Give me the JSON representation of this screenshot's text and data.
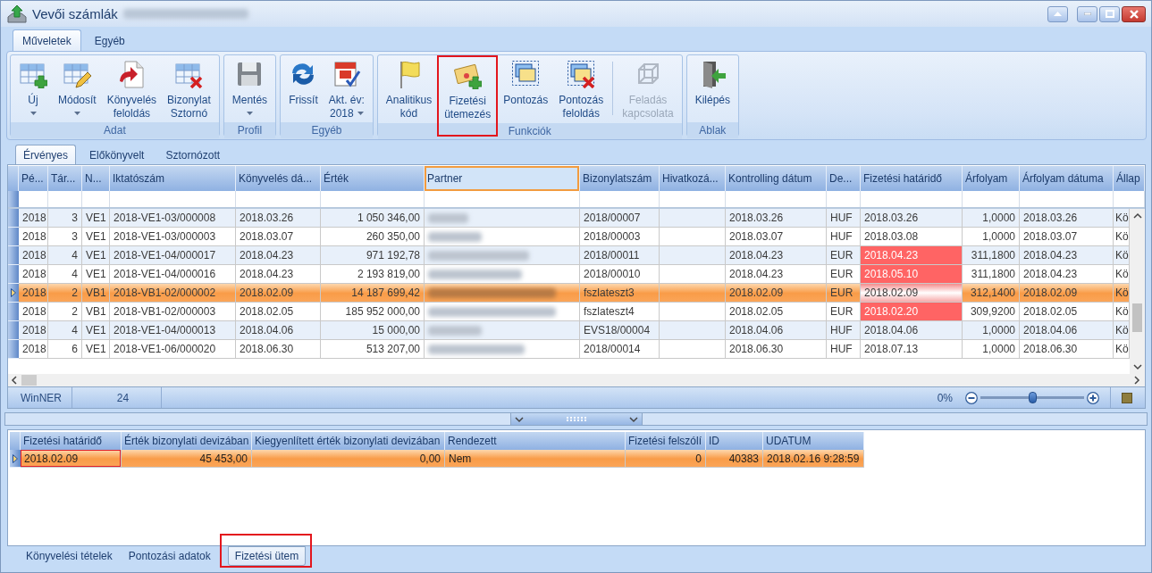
{
  "window": {
    "title": "Vevői számlák"
  },
  "ribbon": {
    "tabs": [
      {
        "label": "Műveletek",
        "selected": true
      },
      {
        "label": "Egyéb",
        "selected": false
      }
    ],
    "groups": [
      {
        "label": "Adat",
        "buttons": [
          {
            "kind": "button",
            "label": "Új",
            "menu": true,
            "disabled": false,
            "highlighted": false
          },
          {
            "kind": "button",
            "label": "Módosít",
            "menu": true,
            "disabled": false,
            "highlighted": false
          },
          {
            "kind": "button",
            "label": "Könyvelés\nfeloldás",
            "menu": false,
            "disabled": false,
            "highlighted": false
          },
          {
            "kind": "button",
            "label": "Bizonylat\nSztornó",
            "menu": false,
            "disabled": false,
            "highlighted": false
          }
        ]
      },
      {
        "label": "Profil",
        "buttons": [
          {
            "kind": "button",
            "label": "Mentés",
            "menu": true,
            "disabled": false,
            "highlighted": false
          }
        ]
      },
      {
        "label": "Egyéb",
        "buttons": [
          {
            "kind": "button",
            "label": "Frissít",
            "menu": false,
            "disabled": false,
            "highlighted": false
          },
          {
            "kind": "button",
            "label": "Akt. év:\n2018",
            "menu": true,
            "disabled": false,
            "highlighted": false
          }
        ]
      },
      {
        "label": "Funkciók",
        "buttons": [
          {
            "kind": "button",
            "label": "Analitikus\nkód",
            "menu": false,
            "disabled": false,
            "highlighted": false
          },
          {
            "kind": "button",
            "label": "Fizetési\nütemezés",
            "menu": false,
            "disabled": false,
            "highlighted": true
          },
          {
            "kind": "button",
            "label": "Pontozás",
            "menu": false,
            "disabled": false,
            "highlighted": false
          },
          {
            "kind": "button",
            "label": "Pontozás\nfeloldás",
            "menu": false,
            "disabled": false,
            "highlighted": false
          },
          {
            "kind": "separator"
          },
          {
            "kind": "button",
            "label": "Feladás\nkapcsolata",
            "menu": false,
            "disabled": true,
            "highlighted": false
          }
        ]
      },
      {
        "label": "Ablak",
        "buttons": [
          {
            "kind": "button",
            "label": "Kilépés",
            "menu": false,
            "disabled": false,
            "highlighted": false
          }
        ]
      }
    ]
  },
  "grid_tabs": [
    {
      "label": "Érvényes",
      "selected": true
    },
    {
      "label": "Előkönyvelt",
      "selected": false
    },
    {
      "label": "Sztornózott",
      "selected": false
    }
  ],
  "grid": {
    "columns": [
      {
        "label": "Pé...",
        "kind": "text",
        "focused": false
      },
      {
        "label": "Tár...",
        "kind": "number",
        "focused": false
      },
      {
        "label": "N...",
        "kind": "text",
        "focused": false
      },
      {
        "label": "Iktatószám",
        "kind": "text",
        "focused": false
      },
      {
        "label": "Könyvelés dá...",
        "kind": "text",
        "focused": false
      },
      {
        "label": "Érték",
        "kind": "number",
        "focused": false
      },
      {
        "label": "Partner",
        "kind": "redacted",
        "focused": true
      },
      {
        "label": "Bizonylatszám",
        "kind": "text",
        "focused": false
      },
      {
        "label": "Hivatkozá...",
        "kind": "text",
        "focused": false
      },
      {
        "label": "Kontrolling dátum",
        "kind": "text",
        "focused": false
      },
      {
        "label": "De...",
        "kind": "text",
        "focused": false
      },
      {
        "label": "Fizetési határidő",
        "kind": "deadline",
        "focused": false
      },
      {
        "label": "Árfolyam",
        "kind": "number",
        "focused": false
      },
      {
        "label": "Árfolyam dátuma",
        "kind": "text",
        "focused": false
      },
      {
        "label": "Állap",
        "kind": "text",
        "focused": false
      }
    ],
    "rows": [
      {
        "selected": false,
        "overdue": false,
        "cells": [
          "2018",
          "3",
          "VE1",
          "2018-VE1-03/000008",
          "2018.03.26",
          "1 050 346,00",
          null,
          "2018/00007",
          null,
          "2018.03.26",
          "HUF",
          "2018.03.26",
          "1,0000",
          "2018.03.26",
          "Kö"
        ]
      },
      {
        "selected": false,
        "overdue": false,
        "cells": [
          "2018",
          "3",
          "VE1",
          "2018-VE1-03/000003",
          "2018.03.07",
          "260 350,00",
          null,
          "2018/00003",
          null,
          "2018.03.07",
          "HUF",
          "2018.03.08",
          "1,0000",
          "2018.03.07",
          "Kö"
        ]
      },
      {
        "selected": false,
        "overdue": true,
        "cells": [
          "2018",
          "4",
          "VE1",
          "2018-VE1-04/000017",
          "2018.04.23",
          "971 192,78",
          null,
          "2018/00011",
          null,
          "2018.04.23",
          "EUR",
          "2018.04.23",
          "311,1800",
          "2018.04.23",
          "Kö"
        ]
      },
      {
        "selected": false,
        "overdue": true,
        "cells": [
          "2018",
          "4",
          "VE1",
          "2018-VE1-04/000016",
          "2018.04.23",
          "2 193 819,00",
          null,
          "2018/00010",
          null,
          "2018.04.23",
          "EUR",
          "2018.05.10",
          "311,1800",
          "2018.04.23",
          "Kö"
        ]
      },
      {
        "selected": true,
        "overdue": true,
        "cells": [
          "2018",
          "2",
          "VB1",
          "2018-VB1-02/000002",
          "2018.02.09",
          "14 187 699,42",
          null,
          "fszlateszt3",
          null,
          "2018.02.09",
          "EUR",
          "2018.02.09",
          "312,1400",
          "2018.02.09",
          "Kö"
        ]
      },
      {
        "selected": false,
        "overdue": true,
        "cells": [
          "2018",
          "2",
          "VB1",
          "2018-VB1-02/000003",
          "2018.02.05",
          "185 952 000,00",
          null,
          "fszlateszt4",
          null,
          "2018.02.05",
          "EUR",
          "2018.02.20",
          "309,9200",
          "2018.02.05",
          "Kö"
        ]
      },
      {
        "selected": false,
        "overdue": false,
        "cells": [
          "2018",
          "4",
          "VE1",
          "2018-VE1-04/000013",
          "2018.04.06",
          "15 000,00",
          null,
          "EVS18/00004",
          null,
          "2018.04.06",
          "HUF",
          "2018.04.06",
          "1,0000",
          "2018.04.06",
          "Kö"
        ]
      },
      {
        "selected": false,
        "overdue": false,
        "cells": [
          "2018",
          "6",
          "VE1",
          "2018-VE1-06/000020",
          "2018.06.30",
          "513 207,00",
          null,
          "2018/00014",
          null,
          "2018.06.30",
          "HUF",
          "2018.07.13",
          "1,0000",
          "2018.06.30",
          "Kö"
        ]
      }
    ]
  },
  "status_bar": {
    "cells": [
      "WinNER",
      "24"
    ],
    "zoom": {
      "label": "0%",
      "level": 0.5
    }
  },
  "details": {
    "columns": [
      {
        "label": "Fizetési határidő",
        "kind": "text"
      },
      {
        "label": "Érték bizonylati devizában",
        "kind": "number"
      },
      {
        "label": "Kiegyenlített érték bizonylati devizában",
        "kind": "number"
      },
      {
        "label": "Rendezett",
        "kind": "text"
      },
      {
        "label": "Fizetési felszólí",
        "kind": "number"
      },
      {
        "label": "ID",
        "kind": "number"
      },
      {
        "label": "UDATUM",
        "kind": "text"
      }
    ],
    "rows": [
      {
        "selected": true,
        "cells": [
          {
            "text": "2018.02.09",
            "focused": true
          },
          {
            "text": "45 453,00",
            "focused": false
          },
          {
            "text": "0,00",
            "focused": false
          },
          {
            "text": "Nem",
            "focused": false
          },
          {
            "text": "0",
            "focused": false
          },
          {
            "text": "40383",
            "focused": false
          },
          {
            "text": "2018.02.16 9:28:59",
            "focused": false
          }
        ]
      }
    ]
  },
  "bottom_tabs": [
    {
      "label": "Könyvelési tételek",
      "selected": false,
      "highlighted": false
    },
    {
      "label": "Pontozási adatok",
      "selected": false,
      "highlighted": false
    },
    {
      "label": "Fizetési ütem",
      "selected": true,
      "highlighted": true
    }
  ]
}
